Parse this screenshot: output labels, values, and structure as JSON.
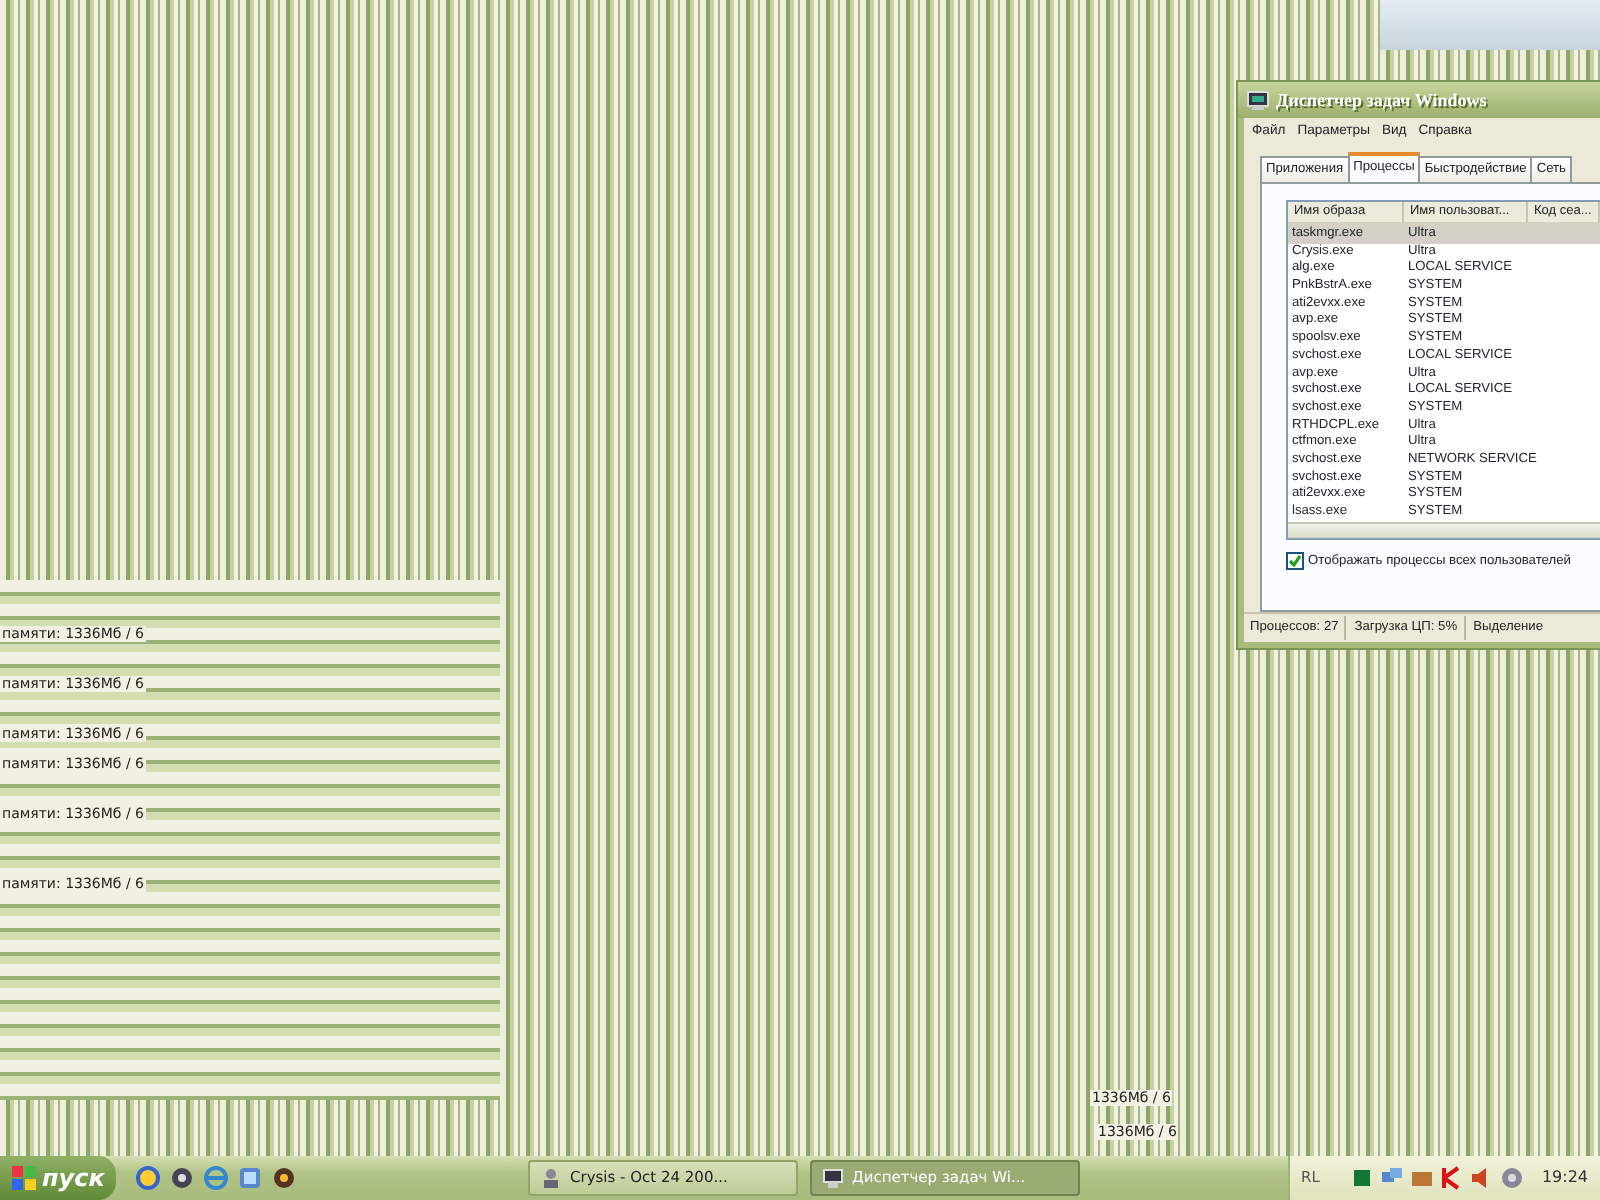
{
  "desktop": {
    "trail_texts": [
      {
        "text": "памяти: 1336Мб / 6"
      },
      {
        "text": "памяти: 1336Мб / 6"
      },
      {
        "text": "памяти: 1336Мб / 6"
      },
      {
        "text": "памяти: 1336Мб / 6"
      },
      {
        "text": "памяти: 1336Мб / 6"
      },
      {
        "text": "памяти: 1336Мб / 6"
      },
      {
        "text": "1336Мб / 6"
      },
      {
        "text": "1336Мб / 6"
      }
    ]
  },
  "window": {
    "title": "Диспетчер задач Windows",
    "menu": [
      "Файл",
      "Параметры",
      "Вид",
      "Справка"
    ],
    "tabs": [
      {
        "label": "Приложения",
        "selected": false
      },
      {
        "label": "Процессы",
        "selected": true
      },
      {
        "label": "Быстродействие",
        "selected": false
      },
      {
        "label": "Сеть",
        "selected": false
      }
    ],
    "table": {
      "columns": [
        "Имя образа",
        "Имя пользоват...",
        "Код сеа..."
      ],
      "rows": [
        {
          "image": "taskmgr.exe",
          "user": "Ultra",
          "selected": true
        },
        {
          "image": "Crysis.exe",
          "user": "Ultra",
          "selected": false
        },
        {
          "image": "alg.exe",
          "user": "LOCAL SERVICE",
          "selected": false
        },
        {
          "image": "PnkBstrA.exe",
          "user": "SYSTEM",
          "selected": false
        },
        {
          "image": "ati2evxx.exe",
          "user": "SYSTEM",
          "selected": false
        },
        {
          "image": "avp.exe",
          "user": "SYSTEM",
          "selected": false
        },
        {
          "image": "spoolsv.exe",
          "user": "SYSTEM",
          "selected": false
        },
        {
          "image": "svchost.exe",
          "user": "LOCAL SERVICE",
          "selected": false
        },
        {
          "image": "avp.exe",
          "user": "Ultra",
          "selected": false
        },
        {
          "image": "svchost.exe",
          "user": "LOCAL SERVICE",
          "selected": false
        },
        {
          "image": "svchost.exe",
          "user": "SYSTEM",
          "selected": false
        },
        {
          "image": "RTHDCPL.exe",
          "user": "Ultra",
          "selected": false
        },
        {
          "image": "ctfmon.exe",
          "user": "Ultra",
          "selected": false
        },
        {
          "image": "svchost.exe",
          "user": "NETWORK SERVICE",
          "selected": false
        },
        {
          "image": "svchost.exe",
          "user": "SYSTEM",
          "selected": false
        },
        {
          "image": "ati2evxx.exe",
          "user": "SYSTEM",
          "selected": false
        },
        {
          "image": "lsass.exe",
          "user": "SYSTEM",
          "selected": false
        }
      ]
    },
    "show_all": {
      "label": "Отображать процессы всех пользователей",
      "checked": true
    },
    "status_bar": [
      "Процессов: 27",
      "Загрузка ЦП: 5%",
      "Выделение"
    ]
  },
  "taskbar": {
    "start": "пуск",
    "tasks": [
      {
        "label": "Crysis - Oct 24 200...",
        "selected": false
      },
      {
        "label": "Диспетчер задач Wi...",
        "selected": true
      }
    ],
    "language": "RL",
    "clock": "19:24"
  }
}
